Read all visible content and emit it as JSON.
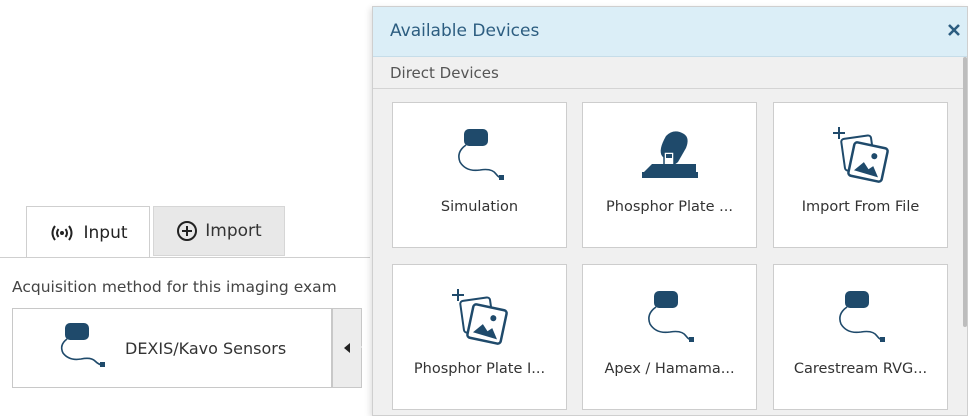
{
  "tabs": {
    "input_label": "Input",
    "import_label": "Import"
  },
  "acquisition": {
    "label": "Acquisition method for this imaging exam",
    "selected_device": "DEXIS/Kavo Sensors"
  },
  "panel": {
    "title": "Available Devices",
    "section": "Direct Devices",
    "devices": [
      {
        "label": "Simulation",
        "icon": "sensor-icon"
      },
      {
        "label": "Phosphor Plate ...",
        "icon": "phosphor-plate-scanner-icon"
      },
      {
        "label": "Import From File",
        "icon": "import-image-icon"
      },
      {
        "label": "Phosphor Plate I...",
        "icon": "import-image-icon"
      },
      {
        "label": "Apex / Hamama...",
        "icon": "sensor-icon"
      },
      {
        "label": "Carestream RVG...",
        "icon": "sensor-icon"
      }
    ]
  },
  "colors": {
    "header_bg": "#dbeef7",
    "title_text": "#2c5d80",
    "icon_dark": "#1f4a6b"
  }
}
